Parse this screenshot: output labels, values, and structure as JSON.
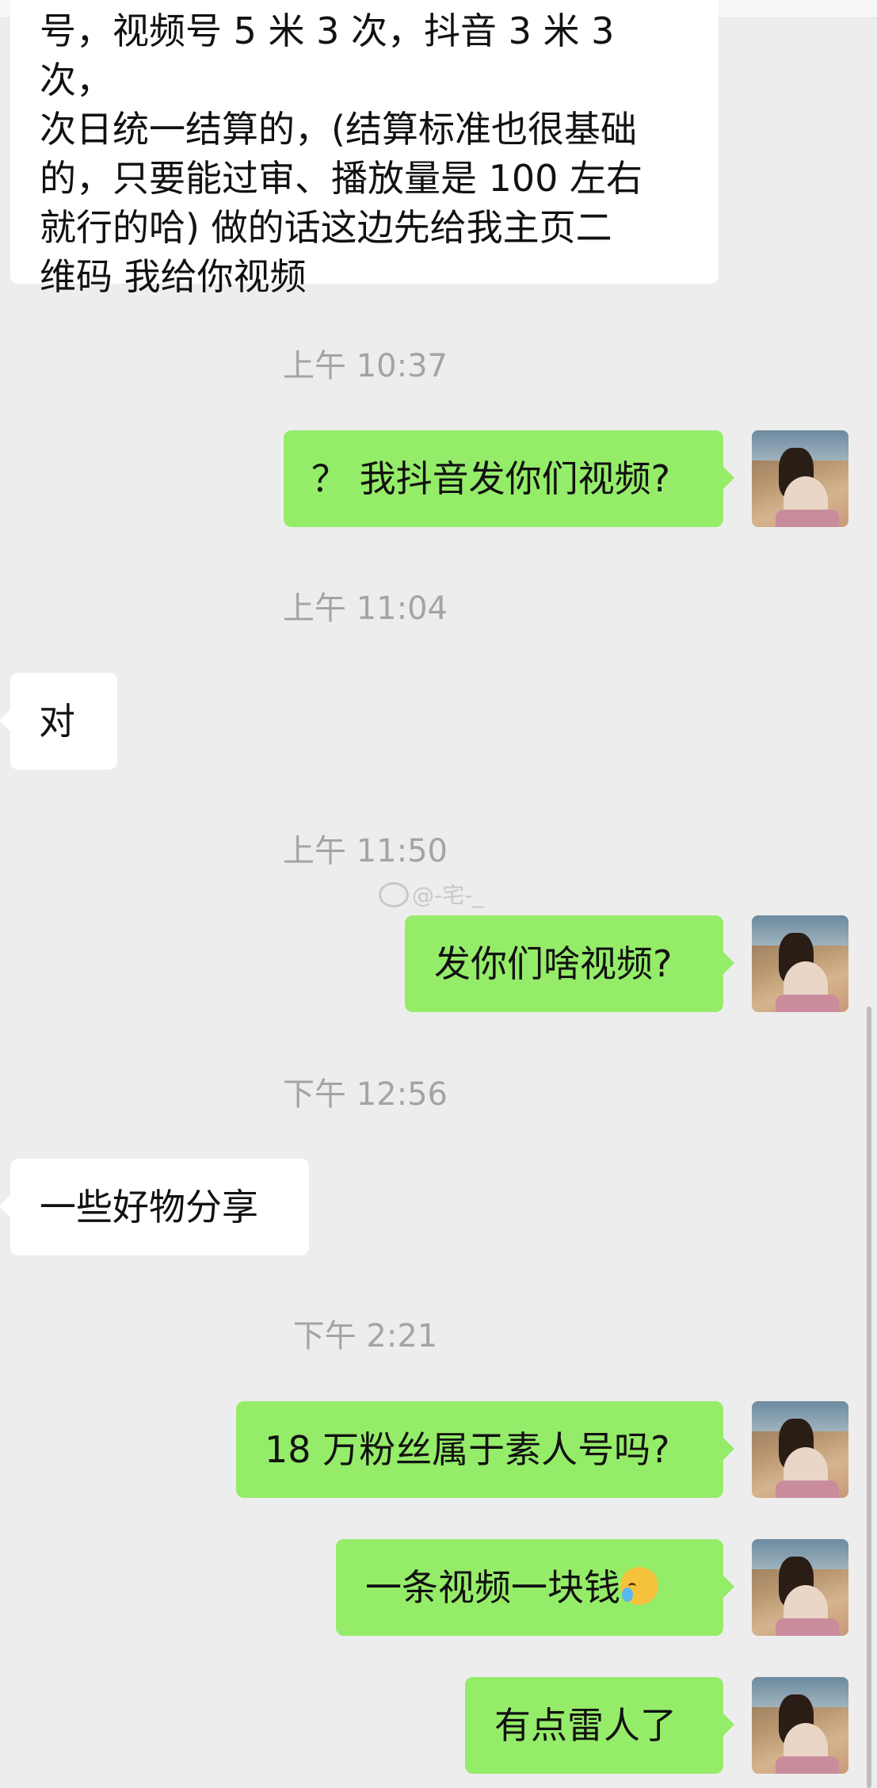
{
  "messages": [
    {
      "type": "incoming",
      "lines": [
        "号，视频号 5 米 3 次，抖音 3 米 3 次，",
        "次日统一结算的，(结算标准也很基础",
        "的，只要能过审、播放量是 100 左右",
        "就行的哈) 做的话这边先给我主页二",
        "维码 我给你视频"
      ]
    }
  ],
  "timestamps": [
    "上午 10:37",
    "上午 11:04",
    "上午 11:50",
    "下午 12:56",
    "下午 2:21"
  ],
  "outgoing": [
    "？ 我抖音发你们视频?",
    "发你们啥视频?",
    "18 万粉丝属于素人号吗?",
    "一条视频一块钱",
    "有点雷人了"
  ],
  "incoming_short": [
    "对",
    "一些好物分享"
  ],
  "watermark": "@-宅-_",
  "emoji_icon": "crying-face-icon",
  "colors": {
    "background": "#ededed",
    "outgoing_bubble": "#95ec69",
    "incoming_bubble": "#ffffff",
    "timestamp_text": "#a4a4a4"
  }
}
